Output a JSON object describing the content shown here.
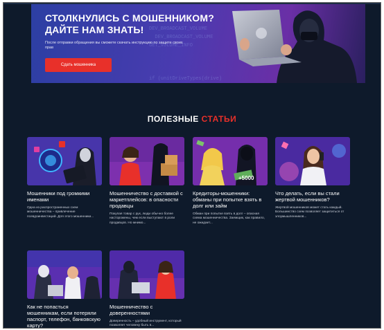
{
  "hero": {
    "title": "Столкнулись с мошенником? Дайте нам знать!",
    "note": "После отправки обращения вы сможете скачать инструкцию по защите своих прав",
    "button_label": "Сдать мошенника",
    "code_text": "DEV_BROADCAST_VOLUME\n  DEV_BROADCAST_VOLUME\nGET_VOLUME_INFO\n\n\n\nif (unitDriveTypes(drive)"
  },
  "section": {
    "title_main": "ПОЛЕЗНЫЕ",
    "title_accent": "СТАТЬИ"
  },
  "articles": [
    {
      "title": "Мошенники под громкими именами",
      "desc": "Одна из распространенных схем мошенничества – привлечение псевдоинвестиций. Для этого мошенники..."
    },
    {
      "title": "Мошенничество с доставкой с маркетплейсов: в опасности продавцы",
      "desc": "Покупая товар с рук, люди обычно более насторожены, чем если выступают в роли продавцов. Но мнимо..."
    },
    {
      "title": "Кредиторы-мошенники: обманы при попытке взять в долг или займ",
      "desc": "Обман при попытке взять в долг – опасная схема мошенничества. Заемщик, как правило, не ожидает...",
      "badge": "+5000"
    },
    {
      "title": "Что делать, если вы стали жертвой мошенников?",
      "desc": "Жертвой мошенников может стать каждый. Большинство схем позволяет защититься от злоумышленников..."
    },
    {
      "title": "Как не попасться мошенникам, если потеряли паспорт, телефон, банковскую карту?",
      "desc": ""
    },
    {
      "title": "Мошенничество с доверенностями",
      "desc": "Доверенность – удобный инструмент, который позволяет человеку быть в..."
    }
  ]
}
